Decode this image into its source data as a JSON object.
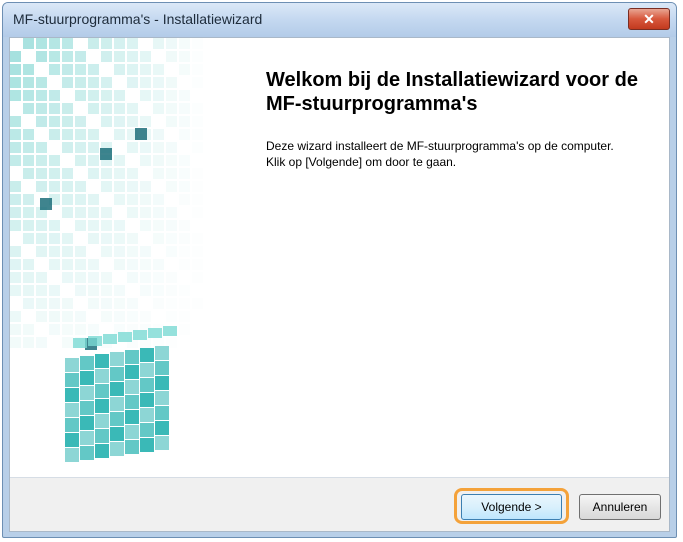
{
  "window": {
    "title": "MF-stuurprogramma's - Installatiewizard",
    "close_icon": "close-icon"
  },
  "wizard": {
    "heading": "Welkom bij de Installatiewizard voor de MF-stuurprogramma's",
    "description": "Deze wizard installeert de MF-stuurprogramma's op de computer. Klik op [Volgende] om door te gaan."
  },
  "buttons": {
    "next_label": "Volgende >",
    "cancel_label": "Annuleren"
  },
  "colors": {
    "accent_highlight": "#f4a23a",
    "cube_teal": "#3fbfbf"
  }
}
